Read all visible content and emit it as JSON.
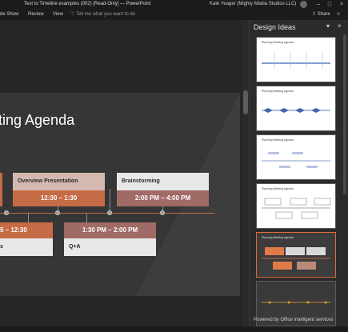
{
  "window": {
    "title": "Text to Timeline examples (002) [Read-Only] — PowerPoint",
    "user": "Kate Yeager (Mighty Media Studios LLC)"
  },
  "ribbon": {
    "tabs": [
      "de Show",
      "Review",
      "View"
    ],
    "search_placeholder": "Tell me what you want to do",
    "share_label": "Share"
  },
  "slide": {
    "title": "ting Agenda",
    "events_top": [
      {
        "title": "Overview Presentation",
        "time": "12:30 – 1:30"
      },
      {
        "title": "Brainstorming",
        "time": "2:00 PM – 4:00 PM"
      }
    ],
    "events_bottom": [
      {
        "time": "5 – 12:30",
        "title": "s"
      },
      {
        "time": "1:30 PM – 2:00 PM",
        "title": "Q+A"
      }
    ]
  },
  "design_ideas": {
    "title": "Design Ideas",
    "cards": [
      {
        "title": "Planning Meeting Agenda"
      },
      {
        "title": "Planning Meeting Agenda"
      },
      {
        "title": "Planning Meeting Agenda"
      },
      {
        "title": "Planning Meeting Agenda"
      },
      {
        "title": "Planning Meeting Agenda"
      },
      {
        "title": ""
      }
    ],
    "footer": "Powered by Office intelligent services"
  },
  "colors": {
    "accent": "#c56b45",
    "selected_border": "#e06a3a",
    "panel_bg": "#2b2b2b",
    "slide_bg": "#363636"
  }
}
